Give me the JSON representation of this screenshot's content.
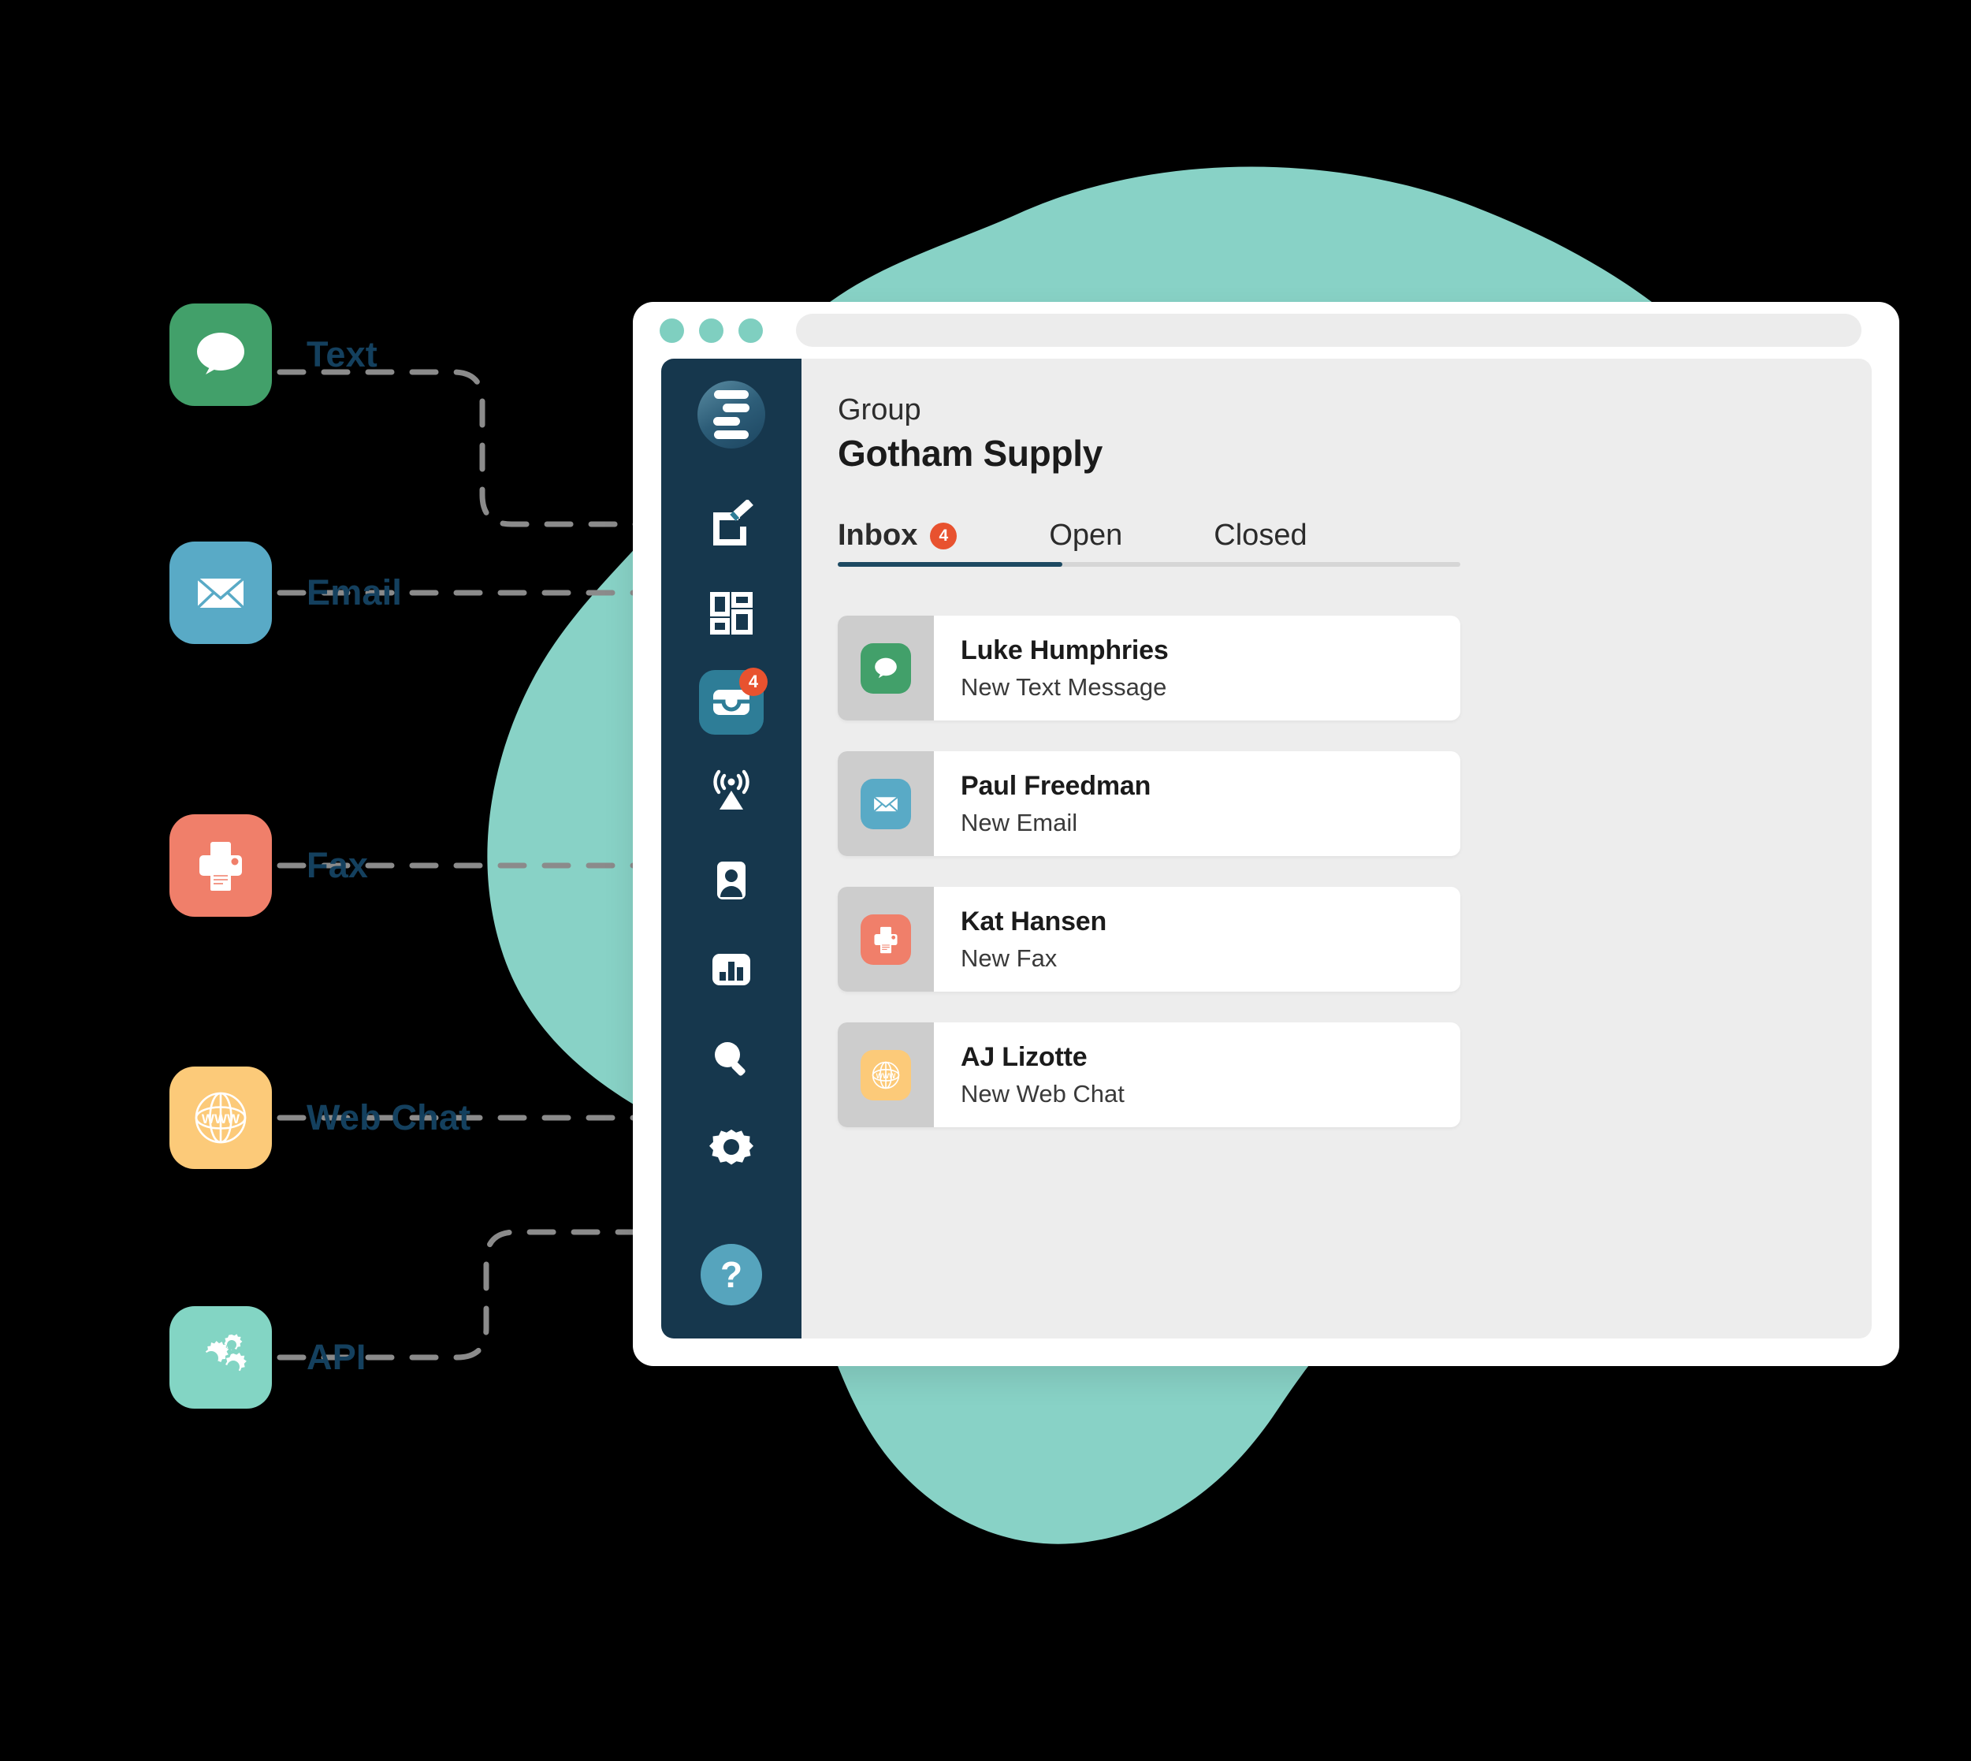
{
  "colors": {
    "blob": "#88d2c6",
    "sidebar": "#16374d",
    "accent_teal": "#2e7d97",
    "badge_orange": "#e8522f",
    "label_navy": "#14405e",
    "text_green": "#42a06a",
    "email_blue": "#59aac6",
    "fax_coral": "#f07f6a",
    "webchat_amber": "#fcca79",
    "api_mint": "#83d5c4"
  },
  "channels": [
    {
      "label": "Text",
      "icon": "chat-bubble-icon",
      "color": "#42a06a"
    },
    {
      "label": "Email",
      "icon": "envelope-icon",
      "color": "#59aac6"
    },
    {
      "label": "Fax",
      "icon": "fax-printer-icon",
      "color": "#f07f6a"
    },
    {
      "label": "Web Chat",
      "icon": "globe-www-icon",
      "color": "#fcca79"
    },
    {
      "label": "API",
      "icon": "gears-icon",
      "color": "#83d5c4"
    }
  ],
  "window": {
    "titlebar": {
      "dots": 3,
      "url_value": ""
    },
    "sidebar": {
      "logo": "hamburger-logo-icon",
      "items": [
        {
          "name": "compose",
          "icon": "compose-pencil-icon",
          "badge": null
        },
        {
          "name": "dashboard",
          "icon": "dashboard-grid-icon",
          "badge": null
        },
        {
          "name": "inbox",
          "icon": "inbox-tray-icon",
          "badge": "4",
          "active": true
        },
        {
          "name": "broadcast",
          "icon": "broadcast-antenna-icon",
          "badge": null
        },
        {
          "name": "contacts",
          "icon": "contact-card-icon",
          "badge": null
        },
        {
          "name": "reports",
          "icon": "bar-chart-icon",
          "badge": null
        },
        {
          "name": "search",
          "icon": "magnifier-icon",
          "badge": null
        },
        {
          "name": "settings",
          "icon": "gear-icon",
          "badge": null
        }
      ],
      "help_label": "?"
    },
    "main": {
      "group_label": "Group",
      "group_name": "Gotham Supply",
      "tabs": [
        {
          "label": "Inbox",
          "badge": "4",
          "active": true
        },
        {
          "label": "Open",
          "badge": null,
          "active": false
        },
        {
          "label": "Closed",
          "badge": null,
          "active": false
        }
      ],
      "messages": [
        {
          "name": "Luke Humphries",
          "subtitle": "New Text Message",
          "icon": "chat-bubble-icon",
          "color": "#42a06a"
        },
        {
          "name": "Paul Freedman",
          "subtitle": "New Email",
          "icon": "envelope-icon",
          "color": "#59aac6"
        },
        {
          "name": "Kat Hansen",
          "subtitle": "New Fax",
          "icon": "fax-printer-icon",
          "color": "#f07f6a"
        },
        {
          "name": "AJ Lizotte",
          "subtitle": "New Web Chat",
          "icon": "globe-www-icon",
          "color": "#fcca79"
        }
      ]
    }
  }
}
